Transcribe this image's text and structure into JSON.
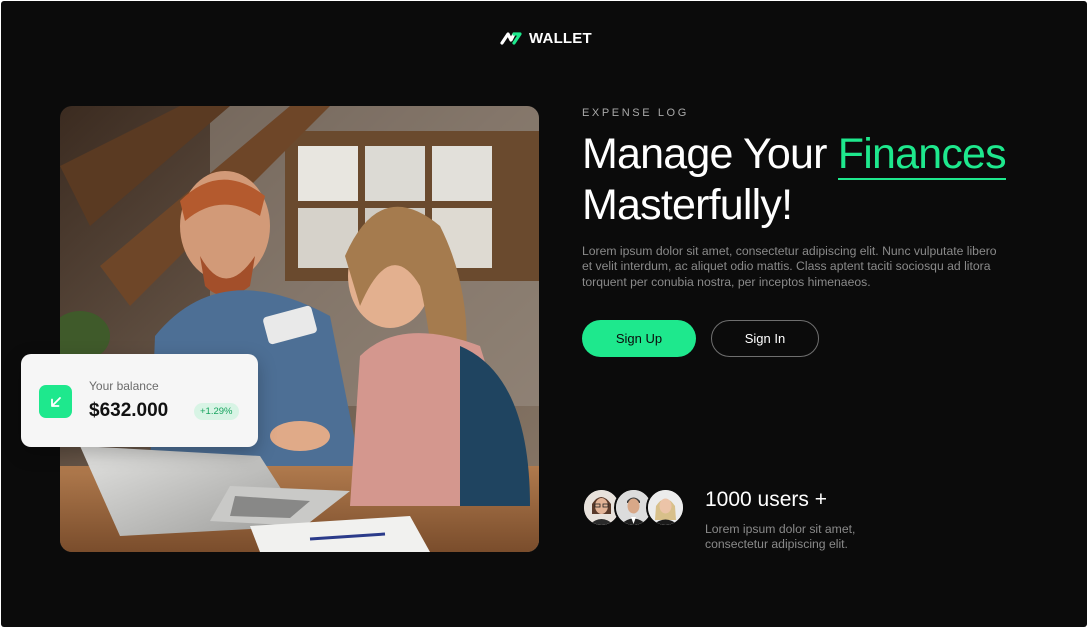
{
  "brand": {
    "name": "WALLET",
    "logo_icon": "zigzag-logo-icon",
    "accent_color": "#1ee88d",
    "background_color": "#0b0b0b"
  },
  "hero": {
    "eyebrow": "EXPENSE LOG",
    "headline_part1": "Manage Your ",
    "headline_accent": "Finances",
    "headline_part2": "Masterfully!",
    "description": "Lorem ipsum dolor sit amet, consectetur adipiscing elit. Nunc vulputate libero et velit interdum, ac aliquet odio mattis. Class aptent taciti sociosqu ad litora torquent per conubia nostra, per inceptos himenaeos.",
    "sign_up_label": "Sign Up",
    "sign_in_label": "Sign In"
  },
  "balance_card": {
    "label": "Your balance",
    "value": "$632.000",
    "change": "+1.29%",
    "icon": "arrow-down-left-icon"
  },
  "users": {
    "title": "1000 users +",
    "description": "Lorem ipsum dolor sit amet, consectetur adipiscing elit.",
    "avatars": [
      "avatar-woman-glasses",
      "avatar-man-suit",
      "avatar-woman-blonde"
    ]
  },
  "photo": {
    "subject": "couple-with-laptop-and-credit-card"
  }
}
